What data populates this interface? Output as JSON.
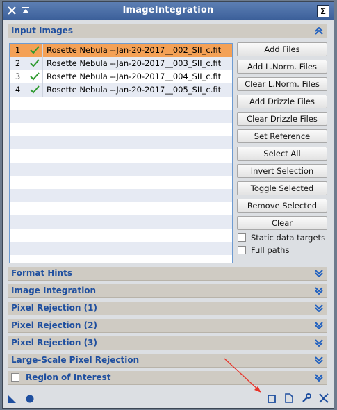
{
  "window": {
    "title": "ImageIntegration"
  },
  "input_images": {
    "header": "Input Images",
    "files": [
      {
        "index": "1",
        "name": "Rosette Nebula --Jan-20-2017__002_SII_c.fit",
        "enabled": true,
        "selected": true
      },
      {
        "index": "2",
        "name": "Rosette Nebula --Jan-20-2017__003_SII_c.fit",
        "enabled": true,
        "selected": false
      },
      {
        "index": "3",
        "name": "Rosette Nebula --Jan-20-2017__004_SII_c.fit",
        "enabled": true,
        "selected": false
      },
      {
        "index": "4",
        "name": "Rosette Nebula --Jan-20-2017__005_SII_c.fit",
        "enabled": true,
        "selected": false
      }
    ],
    "buttons": {
      "add_files": "Add Files",
      "add_lnorm": "Add L.Norm. Files",
      "clear_lnorm": "Clear L.Norm. Files",
      "add_drizzle": "Add Drizzle Files",
      "clear_drizzle": "Clear Drizzle Files",
      "set_reference": "Set Reference",
      "select_all": "Select All",
      "invert_selection": "Invert Selection",
      "toggle_selected": "Toggle Selected",
      "remove_selected": "Remove Selected",
      "clear": "Clear"
    },
    "checkboxes": {
      "static_targets": "Static data targets",
      "full_paths": "Full paths"
    }
  },
  "sections": {
    "format_hints": "Format Hints",
    "image_integration": "Image Integration",
    "pixel_rejection_1": "Pixel Rejection (1)",
    "pixel_rejection_2": "Pixel Rejection (2)",
    "pixel_rejection_3": "Pixel Rejection (3)",
    "large_scale": "Large-Scale Pixel Rejection",
    "roi": "Region of Interest"
  },
  "colors": {
    "title_bar": "#3b5f99",
    "section_label": "#1f4f9f",
    "selected_row": "#f4a156",
    "annotation_arrow": "#e8352b"
  }
}
